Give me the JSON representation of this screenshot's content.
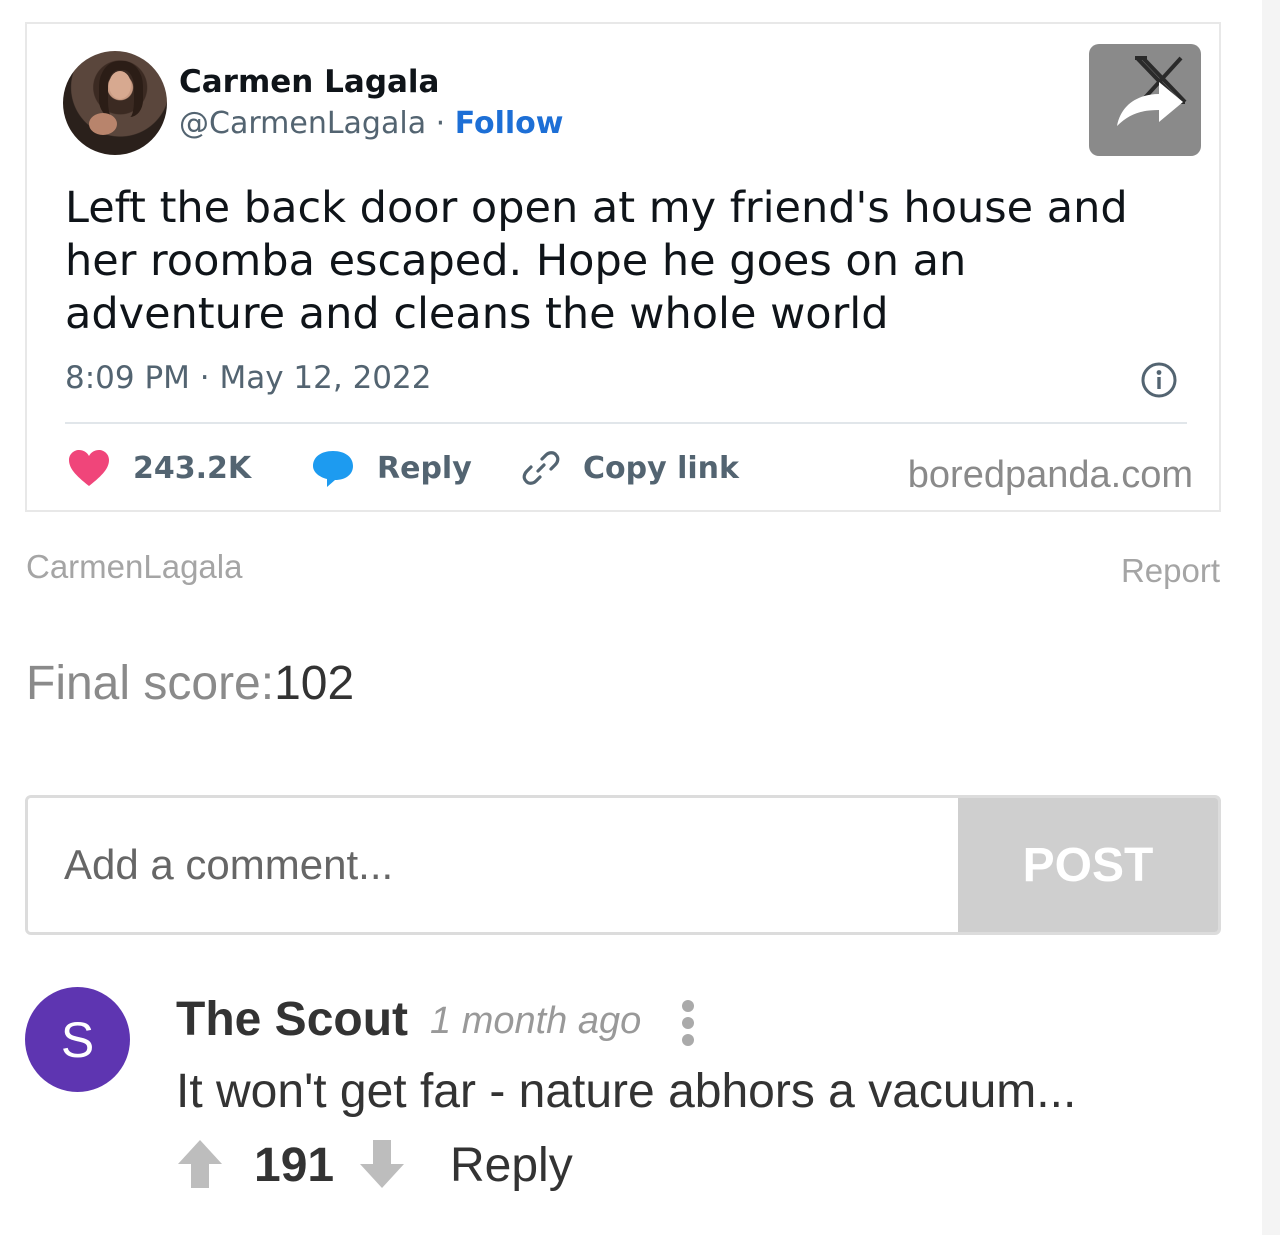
{
  "tweet": {
    "author_name": "Carmen Lagala",
    "handle": "@CarmenLagala",
    "separator": " · ",
    "follow_label": "Follow",
    "text": "Left the back door open at my friend's house and her roomba escaped. Hope he goes on an adventure and cleans the whole world",
    "timestamp": "8:09 PM · May 12, 2022",
    "likes": "243.2K",
    "reply_label": "Reply",
    "copy_link_label": "Copy link",
    "source": "boredpanda.com",
    "icons": [
      "avatar",
      "x-logo",
      "share-arrow-icon",
      "info-icon",
      "heart-icon",
      "comment-bubble-icon",
      "link-icon"
    ],
    "colors": {
      "heart": "#f0457a",
      "bubble": "#1d9bf0",
      "follow": "#1d6fd6"
    }
  },
  "post_meta": {
    "credit": "CarmenLagala",
    "report_label": "Report",
    "final_score_label": "Final score:",
    "final_score_value": "102"
  },
  "comment_form": {
    "placeholder": "Add a comment...",
    "post_label": "POST"
  },
  "comments": [
    {
      "avatar_letter": "S",
      "author": "The Scout",
      "time": "1 month ago",
      "text": "It won't get far - nature abhors a vacuum...",
      "score": "191",
      "reply_label": "Reply",
      "avatar_color": "#5e35b1"
    }
  ]
}
